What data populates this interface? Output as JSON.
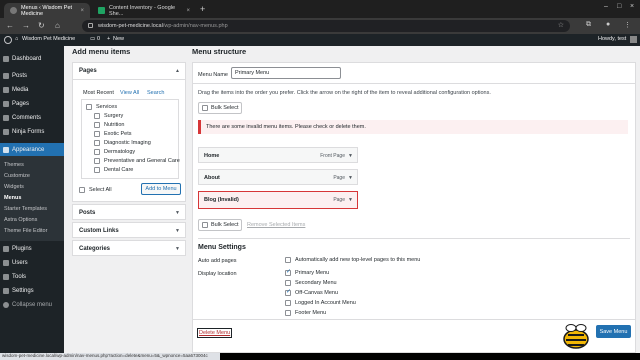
{
  "browser": {
    "tabs": [
      {
        "title": "Menus ‹ Wisdom Pet Medicine"
      },
      {
        "title": "Content Inventory - Google She..."
      }
    ],
    "url_host": "wisdom-pet-medicine.local",
    "url_path": "/wp-admin/nav-menus.php",
    "status_url": "wisdom-pet-medicine.local/wp-admin/nav-menus.php?action=delete&menu=5&_wpnonce=5aa673004c"
  },
  "adminbar": {
    "site_name": "Wisdom Pet Medicine",
    "comments": "0",
    "new_label": "New",
    "greeting": "Howdy, test"
  },
  "sidebar": {
    "items": [
      {
        "label": "Dashboard",
        "icon": "dashboard-icon"
      },
      {
        "label": "Posts",
        "icon": "pin-icon"
      },
      {
        "label": "Media",
        "icon": "media-icon"
      },
      {
        "label": "Pages",
        "icon": "page-icon"
      },
      {
        "label": "Comments",
        "icon": "comment-icon"
      },
      {
        "label": "Ninja Forms",
        "icon": "form-icon"
      },
      {
        "label": "Appearance",
        "icon": "brush-icon"
      }
    ],
    "appearance_sub": [
      "Themes",
      "Customize",
      "Widgets",
      "Menus",
      "Starter Templates",
      "Astra Options",
      "Theme File Editor"
    ],
    "items_after": [
      {
        "label": "Plugins",
        "icon": "plugin-icon"
      },
      {
        "label": "Users",
        "icon": "users-icon"
      },
      {
        "label": "Tools",
        "icon": "tools-icon"
      },
      {
        "label": "Settings",
        "icon": "settings-icon"
      }
    ],
    "collapse": "Collapse menu"
  },
  "add_items": {
    "heading": "Add menu items",
    "pages_title": "Pages",
    "tabs": [
      "Most Recent",
      "View All",
      "Search"
    ],
    "pages": [
      {
        "label": "Services",
        "indent": 0
      },
      {
        "label": "Surgery",
        "indent": 1
      },
      {
        "label": "Nutrition",
        "indent": 1
      },
      {
        "label": "Exotic Pets",
        "indent": 1
      },
      {
        "label": "Diagnostic Imaging",
        "indent": 1
      },
      {
        "label": "Dermatology",
        "indent": 1
      },
      {
        "label": "Preventative and General Care",
        "indent": 1
      },
      {
        "label": "Dental Care",
        "indent": 1
      }
    ],
    "select_all": "Select All",
    "add_button": "Add to Menu",
    "other_sections": [
      "Posts",
      "Custom Links",
      "Categories"
    ]
  },
  "structure": {
    "heading": "Menu structure",
    "menu_name_label": "Menu Name",
    "menu_name_value": "Primary Menu",
    "instructions": "Drag the items into the order you prefer. Click the arrow on the right of the item to reveal additional configuration options.",
    "bulk_select": "Bulk Select",
    "notice": "There are some invalid menu items. Please check or delete them.",
    "items": [
      {
        "title": "Home",
        "type": "Front Page",
        "invalid": false
      },
      {
        "title": "About",
        "type": "Page",
        "invalid": false
      },
      {
        "title": "Blog (Invalid)",
        "type": "Page",
        "invalid": true
      }
    ],
    "remove_selected": "Remove Selected Items",
    "settings_heading": "Menu Settings",
    "auto_add_label": "Auto add pages",
    "auto_add_option": "Automatically add new top-level pages to this menu",
    "display_label": "Display location",
    "locations": [
      {
        "label": "Primary Menu",
        "checked": true
      },
      {
        "label": "Secondary Menu",
        "checked": false
      },
      {
        "label": "Off-Canvas Menu",
        "checked": true
      },
      {
        "label": "Logged In Account Menu",
        "checked": false
      },
      {
        "label": "Footer Menu",
        "checked": false
      }
    ],
    "delete_menu": "Delete Menu",
    "save_menu": "Save Menu"
  }
}
